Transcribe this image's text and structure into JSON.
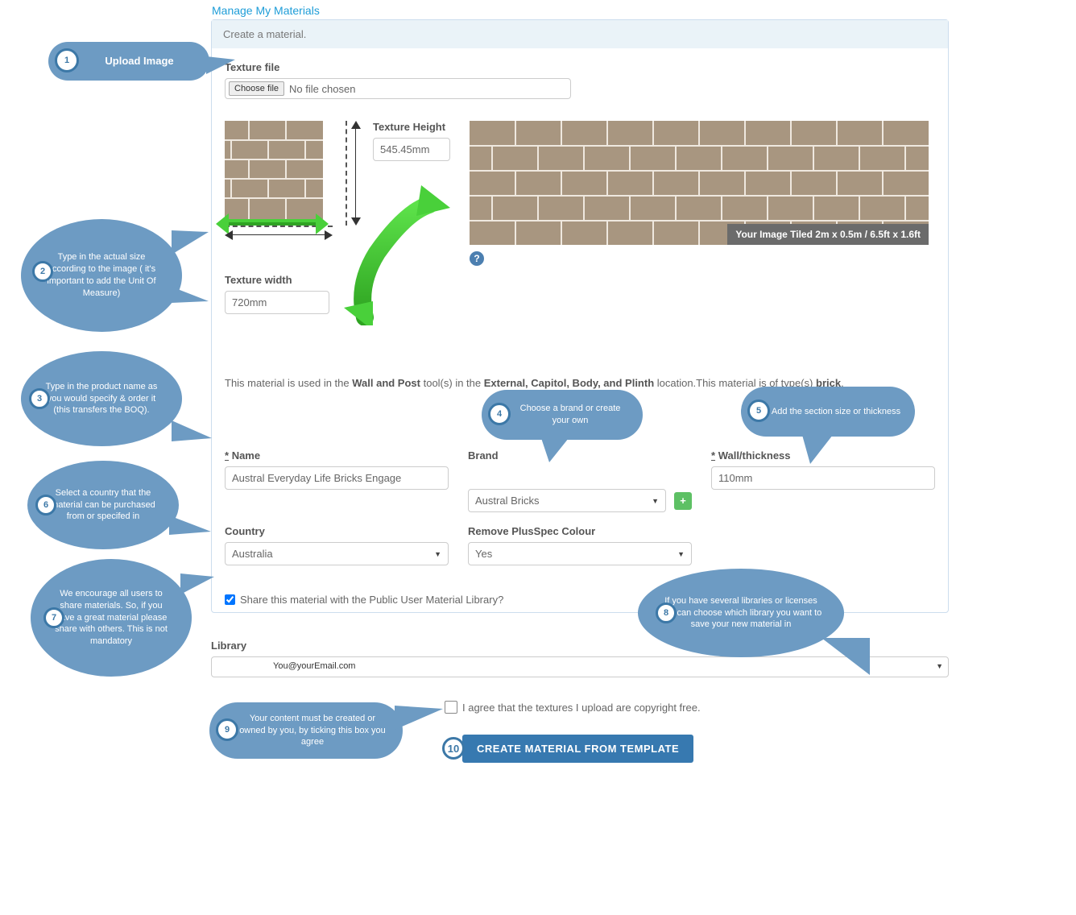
{
  "breadcrumb": "Manage My Materials",
  "panel_title": "Create a material.",
  "texture": {
    "file_label": "Texture file",
    "choose_btn": "Choose file",
    "no_file": "No file chosen",
    "height_label": "Texture Height",
    "height_value": "545.45mm",
    "width_label": "Texture width",
    "width_value": "720mm"
  },
  "preview_caption": "Your Image Tiled 2m x 0.5m / 6.5ft x 1.6ft",
  "help_q": "?",
  "usage": {
    "pre": "This material is used in the ",
    "tool": "Wall and Post",
    "mid1": " tool(s) in the ",
    "location": "External, Capitol, Body, and Plinth",
    "mid2": " location.This material is of type(s) ",
    "type": "brick",
    "post": "."
  },
  "fields": {
    "name_label": "Name",
    "name_value": "Austral Everyday Life Bricks Engage",
    "brand_label": "Brand",
    "brand_value": "Austral Bricks",
    "plus": "+",
    "wall_label": "Wall/thickness",
    "wall_value": "110mm",
    "country_label": "Country",
    "country_value": "Australia",
    "remove_label": "Remove PlusSpec Colour",
    "remove_value": "Yes"
  },
  "share_label": "Share this material with the Public User Material Library?",
  "library": {
    "label": "Library",
    "email": "You@yourEmail.com"
  },
  "agree_text": "I agree that the textures I upload are copyright free.",
  "create_btn": "CREATE MATERIAL FROM TEMPLATE",
  "callouts": {
    "c1": {
      "num": "1",
      "text": "Upload Image"
    },
    "c2": {
      "num": "2",
      "text": "Type in the actual size according to the image ( it's important to add the Unit Of Measure)"
    },
    "c3": {
      "num": "3",
      "text": "Type in the product name as you would specify & order it (this transfers the BOQ)."
    },
    "c4": {
      "num": "4",
      "text": "Choose a brand or create your own"
    },
    "c5": {
      "num": "5",
      "text": "Add the section size or thickness"
    },
    "c6": {
      "num": "6",
      "text": "Select a country that the material can be purchased from or specifed in"
    },
    "c7": {
      "num": "7",
      "text": "We encourage all users to share materials. So, if you have a great material please share with others. This is not mandatory"
    },
    "c8": {
      "num": "8",
      "text": "If you have several libraries or licenses you can choose which library you want to save your new material in"
    },
    "c9": {
      "num": "9",
      "text": "Your content must be created or owned by you, by ticking this box you agree"
    },
    "c10": {
      "num": "10"
    }
  }
}
